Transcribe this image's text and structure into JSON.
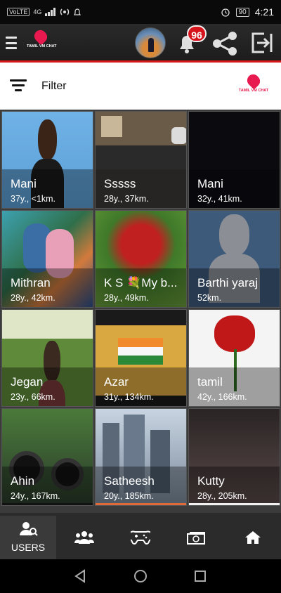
{
  "status_bar": {
    "volte": "VoLTE",
    "network": "4G",
    "battery": "90",
    "time": "4:21"
  },
  "header": {
    "logo_text": "TAMIL VM CHAT",
    "notification_count": "96",
    "icons": [
      "menu-icon",
      "avatar",
      "bell-icon",
      "share-icon",
      "exit-icon"
    ]
  },
  "filter": {
    "label": "Filter",
    "logo_text": "TAMIL VM CHAT"
  },
  "users": [
    {
      "name": "Mani",
      "meta": "37y., <1km."
    },
    {
      "name": "Sssss",
      "meta": "28y., 37km."
    },
    {
      "name": "Mani",
      "meta": "32y., 41km."
    },
    {
      "name": "Mithran",
      "meta": "28y., 42km."
    },
    {
      "name": "K S 💐My b...",
      "meta": "28y., 49km."
    },
    {
      "name": "Barthi yaraj",
      "meta": "52km."
    },
    {
      "name": "Jegan",
      "meta": "23y., 66km."
    },
    {
      "name": "Azar",
      "meta": "31y., 134km."
    },
    {
      "name": "tamil",
      "meta": "42y., 166km."
    },
    {
      "name": "Ahin",
      "meta": "24y., 167km."
    },
    {
      "name": "Satheesh",
      "meta": "20y., 185km."
    },
    {
      "name": "Kutty",
      "meta": "28y., 205km."
    }
  ],
  "bottom_nav": {
    "active_label": "USERS",
    "items": [
      "users-search-icon",
      "group-icon",
      "gamepad-icon",
      "money-icon",
      "home-icon"
    ]
  },
  "colors": {
    "accent_red": "#d61a1a",
    "badge_red": "#d6141c",
    "logo_pink": "#e8194f"
  }
}
